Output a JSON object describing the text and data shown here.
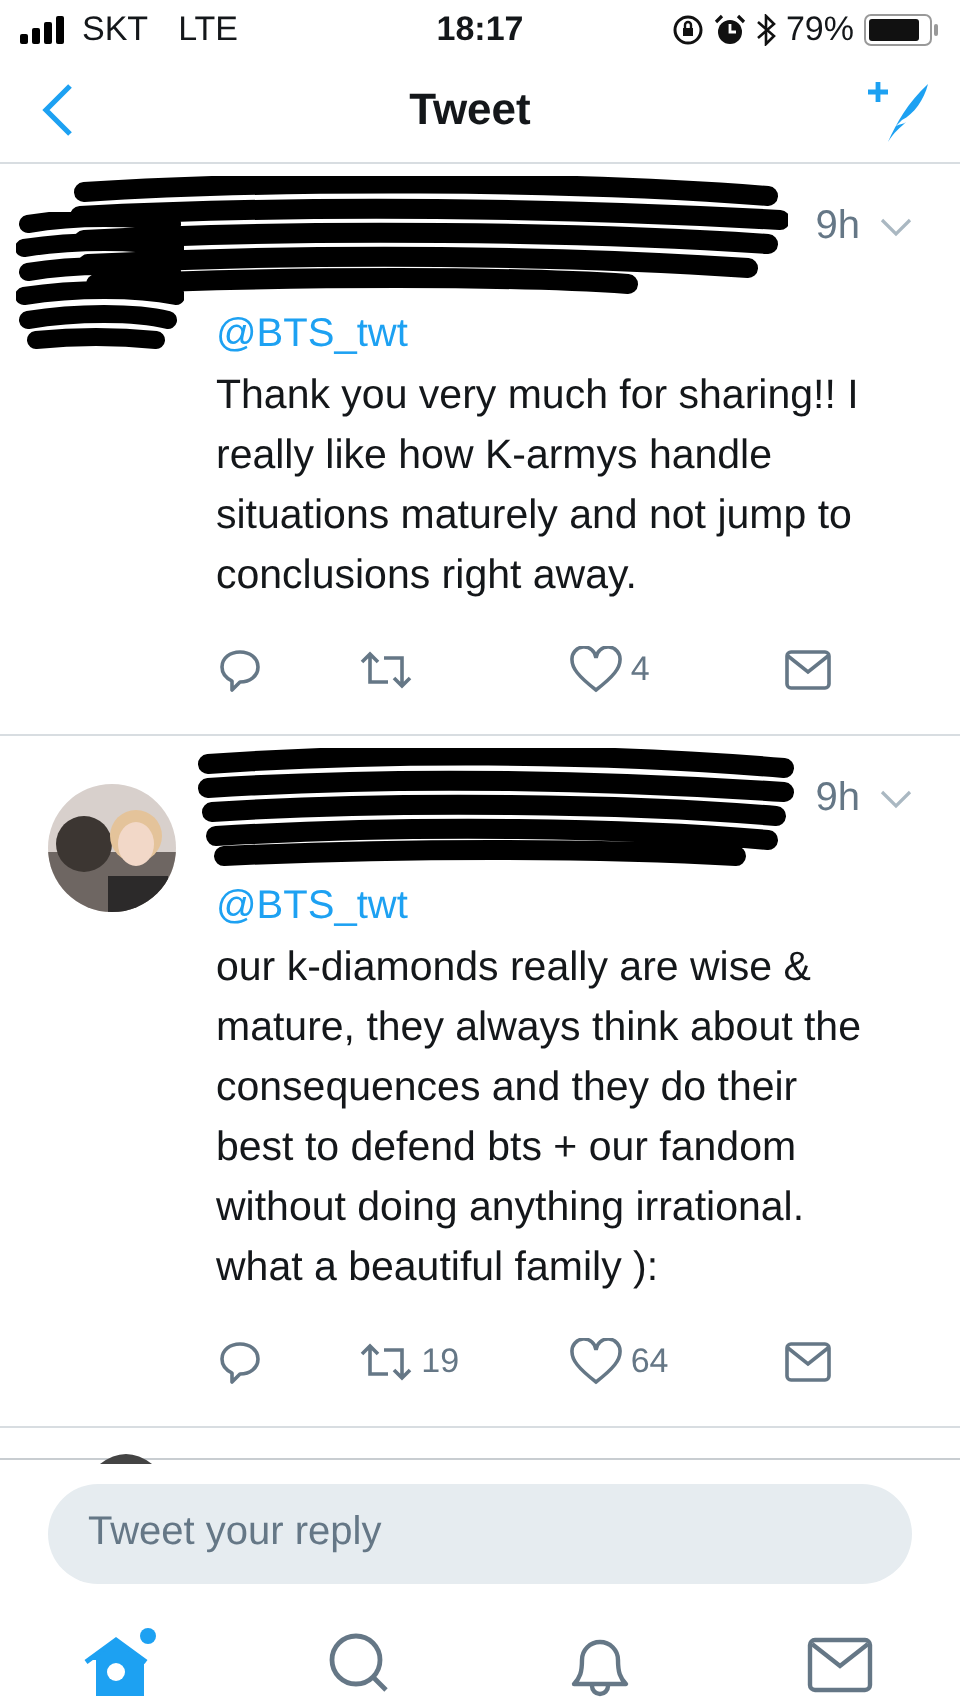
{
  "status_bar": {
    "carrier": "SKT",
    "network": "LTE",
    "time": "18:17",
    "battery": "79%"
  },
  "header": {
    "title": "Tweet"
  },
  "tweets": [
    {
      "avatar_hidden": true,
      "time": "9h",
      "mention": "@BTS_twt",
      "text": "Thank you very much for sharing!! I really like how K-armys handle situations maturely and not jump to conclusions right away.",
      "likes": "4"
    },
    {
      "avatar_hidden": false,
      "time": "9h",
      "mention": "@BTS_twt",
      "text": "our k-diamonds really are wise & mature, they always think about the consequences and they do their best to defend bts + our fandom without doing anything irrational. what a beautiful family ):",
      "retweets": "19",
      "likes": "64"
    }
  ],
  "reply": {
    "placeholder": "Tweet your reply"
  },
  "tabs": [
    {
      "kind": "home",
      "selected": true,
      "badge": true
    },
    {
      "kind": "search",
      "selected": false,
      "badge": false
    },
    {
      "kind": "notifications",
      "selected": false,
      "badge": false
    },
    {
      "kind": "messages",
      "selected": false,
      "badge": false
    }
  ]
}
